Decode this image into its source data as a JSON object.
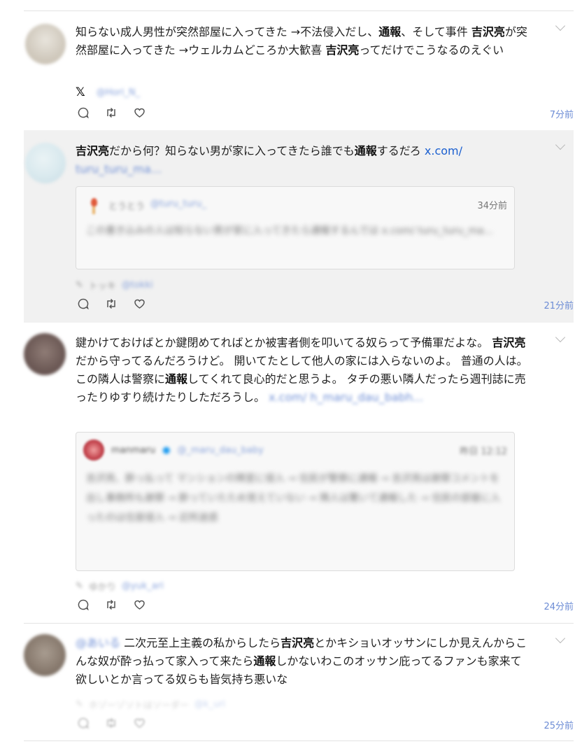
{
  "posts": [
    {
      "text_html": "知らない成人男性が突然部屋に入ってきた →不法侵入だし、<b>通報</b>、そして事件 <b>吉沢亮</b>が突然部屋に入ってきた →ウェルカムどころか大歓喜 <b>吉沢亮</b>ってだけでこうなるのえぐい",
      "source_user": "",
      "source_handle": "@Hori_N_",
      "time": "7分前"
    },
    {
      "text_html": "<b>吉沢亮</b>だから何？知らない男が家に入ってきたら誰でも<b>通報</b>するだろ <span class=\"link\">x.com/</span>",
      "text_blur": "turu_turu_ma...",
      "card_user": "とうとう",
      "card_handle": "@turu_turu_",
      "card_time": "34分前",
      "card_text": "この書き込みの人は知らない男が家に入ってきたら通報するんでは x.com/ turu_turu_ma...",
      "source_user": "トッキ",
      "source_handle": "@tokki",
      "time": "21分前"
    },
    {
      "text_html": "鍵かけておけばとか鍵閉めてればとか被害者側を叩いてる奴らって予備軍だよな。 <b>吉沢亮</b>だから守ってるんだろうけど。 開いてたとして他人の家には入らないのよ。 普通の人は。 この隣人は警察に<b>通報</b>してくれて良心的だと思うよ。 タチの悪い隣人だったら週刊誌に売ったりゆすり続けたりしただろうし。",
      "text_blur": "x.com/ h_maru_dau_babh...",
      "card_user": "manmaru",
      "card_handle": "@_maru_dau_baby",
      "card_time": "昨日 12:12",
      "card_text": "吉沢亮、酔っ払って マンションの隣室に侵入 → 住民が警察に通報 → 吉沢亮は謝罪コメントを出し事務所も謝罪 → 酔っていたため覚えていない → 隣人は驚いて通報した → 住民の部屋に入ったのは住居侵入 → 近所迷惑",
      "source_user": "ゆかり",
      "source_handle": "@yuk_ari",
      "time": "24分前"
    },
    {
      "text_prefix_blur": "@あいる",
      "text_html": "二次元至上主義の私からしたら<b>吉沢亮</b>とかキショいオッサンにしか見えんからこんな奴が酔っ払って家入って来たら<b>通報</b>しかないわこのオッサン庇ってるファンも家来て欲しいとか言ってる奴らも皆気持ち悪いな",
      "source_user": "ホゾーゾソトはソーダー",
      "source_handle": "@k_uri",
      "time": "25分前"
    }
  ],
  "colors": {
    "link": "#1a5fd0",
    "time": "#6c8cd5",
    "highlight": "#f1f1f1"
  }
}
